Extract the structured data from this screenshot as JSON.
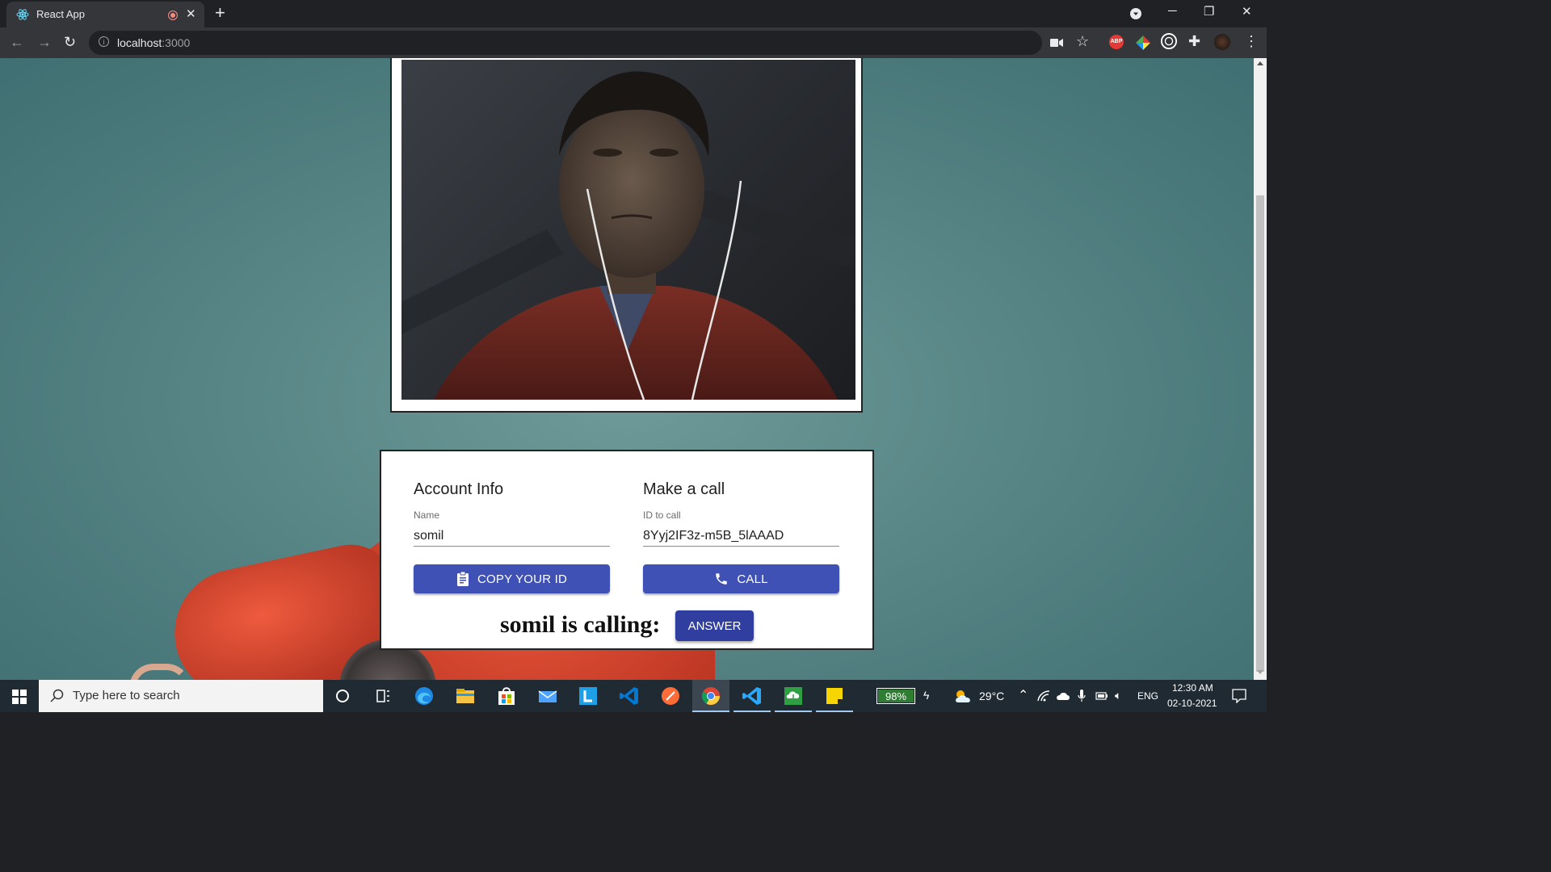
{
  "browser": {
    "tab_title": "React App",
    "url_host": "localhost",
    "url_port": ":3000"
  },
  "account": {
    "title": "Account Info",
    "name_label": "Name",
    "name_value": "somil",
    "copy_button": "COPY YOUR ID"
  },
  "call": {
    "title": "Make a call",
    "id_label": "ID to call",
    "id_value": "8Yyj2IF3z-m5B_5lAAAD",
    "call_button": "CALL"
  },
  "incoming": {
    "text": "somil is calling:",
    "answer_button": "ANSWER"
  },
  "taskbar": {
    "search_placeholder": "Type here to search",
    "battery": "98%",
    "temperature": "29°C",
    "language": "ENG",
    "time": "12:30 AM",
    "date": "02-10-2021"
  },
  "colors": {
    "primary": "#3f51b5",
    "answer": "#303f9f"
  }
}
